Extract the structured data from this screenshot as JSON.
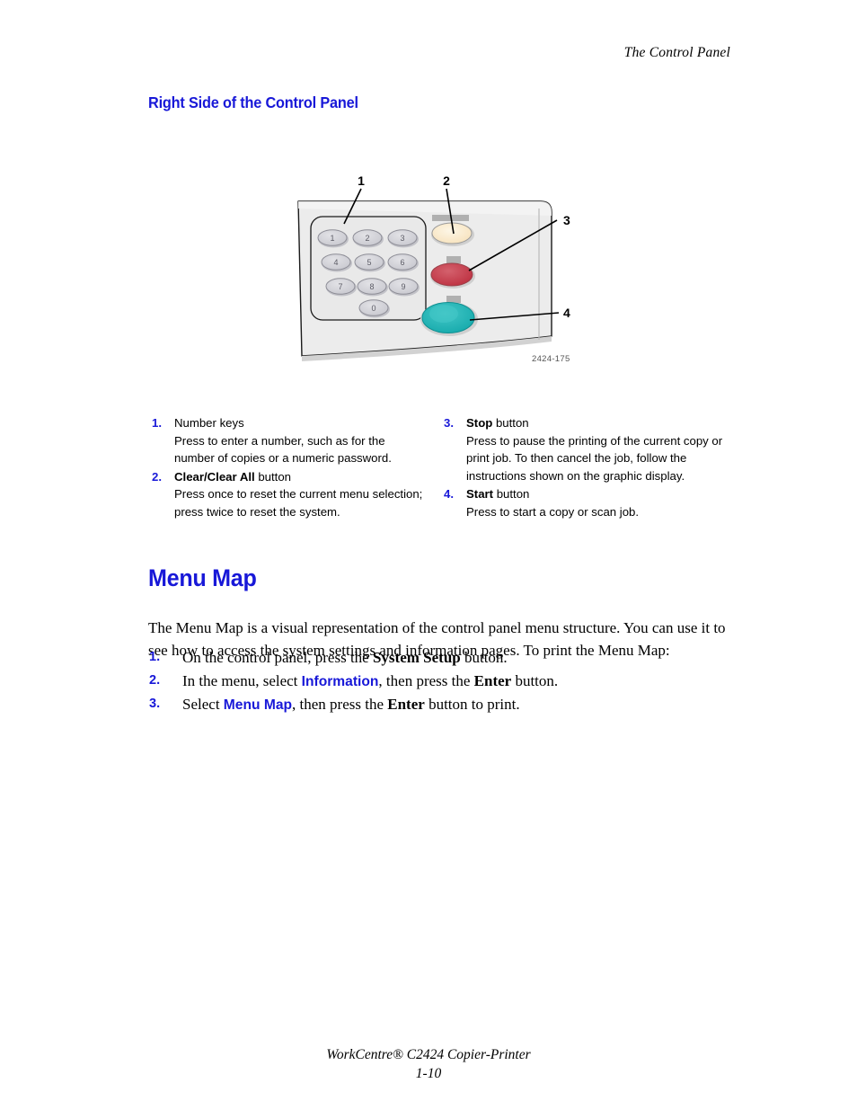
{
  "header": {
    "running_head": "The Control Panel"
  },
  "sections": {
    "subheading": "Right Side of the Control Panel",
    "menu_map_heading": "Menu Map"
  },
  "figure": {
    "caption": "2424-175",
    "callout_labels": [
      "1",
      "2",
      "3",
      "4"
    ],
    "keypad_keys": [
      "1",
      "2",
      "3",
      "4",
      "5",
      "6",
      "7",
      "8",
      "9",
      "0"
    ],
    "colors": {
      "panel_face": "#e8e8e8",
      "panel_edge": "#1a1a1a",
      "key_fill": "#d8d8dc",
      "clear_button": "#fbeacb",
      "stop_button": "#c8414f",
      "start_button": "#21b5b5",
      "label_bar": "#b4b4b4"
    }
  },
  "callouts": {
    "left": [
      {
        "num": "1.",
        "title_bold": "",
        "title_rest": "Number keys",
        "body": "Press to enter a number, such as for the number of copies or a numeric password."
      },
      {
        "num": "2.",
        "title_bold": "Clear/Clear All",
        "title_rest": " button",
        "body": "Press once to reset the current menu selection; press twice to reset the system."
      }
    ],
    "right": [
      {
        "num": "3.",
        "title_bold": "Stop",
        "title_rest": " button",
        "body": "Press to pause the printing of the current copy or print job. To then cancel the job, follow the instructions shown on the graphic display."
      },
      {
        "num": "4.",
        "title_bold": "Start",
        "title_rest": " button",
        "body": "Press to start a copy or scan job."
      }
    ]
  },
  "menu_map": {
    "intro": "The Menu Map is a visual representation of the control panel menu structure. You can use it to see how to access the system settings and information pages. To print the Menu Map:",
    "steps": [
      {
        "num": "1.",
        "pre": "On the control panel, press the ",
        "bold": "System Setup",
        "post": " button."
      },
      {
        "num": "2.",
        "pre": "In the menu, select ",
        "blue": "Information",
        "mid": ", then press the ",
        "bold": "Enter",
        "post": " button."
      },
      {
        "num": "3.",
        "pre": "Select ",
        "blue": "Menu Map",
        "mid": ", then press the ",
        "bold": "Enter",
        "post": " button to print."
      }
    ]
  },
  "footer": {
    "product": "WorkCentre® C2424 Copier-Printer",
    "page_number": "1-10"
  }
}
